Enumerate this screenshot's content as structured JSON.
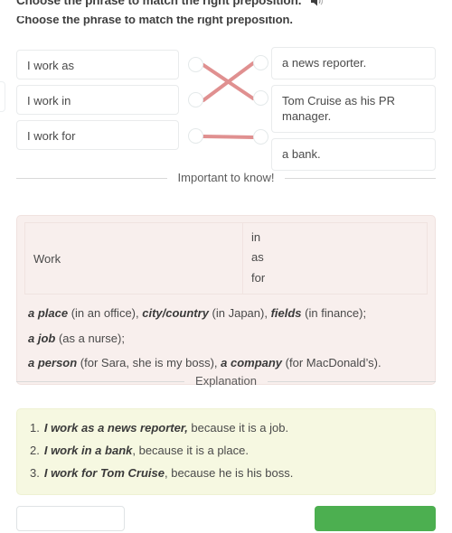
{
  "header": {
    "title": "Choose the phrase to match the right preposition.",
    "audio_icon": "speaker-icon"
  },
  "subline": {
    "text": "Choose the phrase to match the right preposition."
  },
  "matching": {
    "left_items": [
      {
        "label": "I work as"
      },
      {
        "label": "I work in"
      },
      {
        "label": "I work for"
      }
    ],
    "right_items": [
      {
        "label": "a news reporter."
      },
      {
        "label": "Tom Cruise as his PR manager."
      },
      {
        "label": "a bank."
      }
    ],
    "connections": [
      {
        "from": 1,
        "to": 2
      },
      {
        "from": 2,
        "to": 1
      },
      {
        "from": 3,
        "to": 3
      }
    ],
    "line_color": "#e09090"
  },
  "important": {
    "divider_label": "Important to know!",
    "table": {
      "word": "Work",
      "prepositions": [
        "in",
        "as",
        "for"
      ]
    },
    "notes": [
      {
        "parts": [
          {
            "text": "a place",
            "bold": true
          },
          {
            "text": " (in an office), ",
            "bold": false
          },
          {
            "text": "city/country",
            "bold": true
          },
          {
            "text": " (in Japan), ",
            "bold": false
          },
          {
            "text": "fields",
            "bold": true
          },
          {
            "text": " (in finance);",
            "bold": false
          }
        ]
      },
      {
        "parts": [
          {
            "text": "a job",
            "bold": true
          },
          {
            "text": " (as a nurse);",
            "bold": false
          }
        ]
      },
      {
        "parts": [
          {
            "text": "a person",
            "bold": true
          },
          {
            "text": " (for Sara, she is my boss), ",
            "bold": false
          },
          {
            "text": "a company",
            "bold": true
          },
          {
            "text": " (for MacDonald’s).",
            "bold": false
          }
        ]
      }
    ]
  },
  "explanation": {
    "divider_label": "Explanation",
    "items": [
      {
        "number": "1.",
        "parts": [
          {
            "text": "I work as a news reporter,",
            "bold": true
          },
          {
            "text": " because it is a job.",
            "bold": false
          }
        ]
      },
      {
        "number": "2.",
        "parts": [
          {
            "text": "I work in a bank",
            "bold": true
          },
          {
            "text": ", because it is a place.",
            "bold": false
          }
        ]
      },
      {
        "number": "3.",
        "parts": [
          {
            "text": "I work for Tom Cruise",
            "bold": true
          },
          {
            "text": ", because he is his boss.",
            "bold": false
          }
        ]
      }
    ]
  },
  "footer": {
    "secondary_label": "",
    "primary_label": "",
    "primary_color": "#4caf50"
  }
}
